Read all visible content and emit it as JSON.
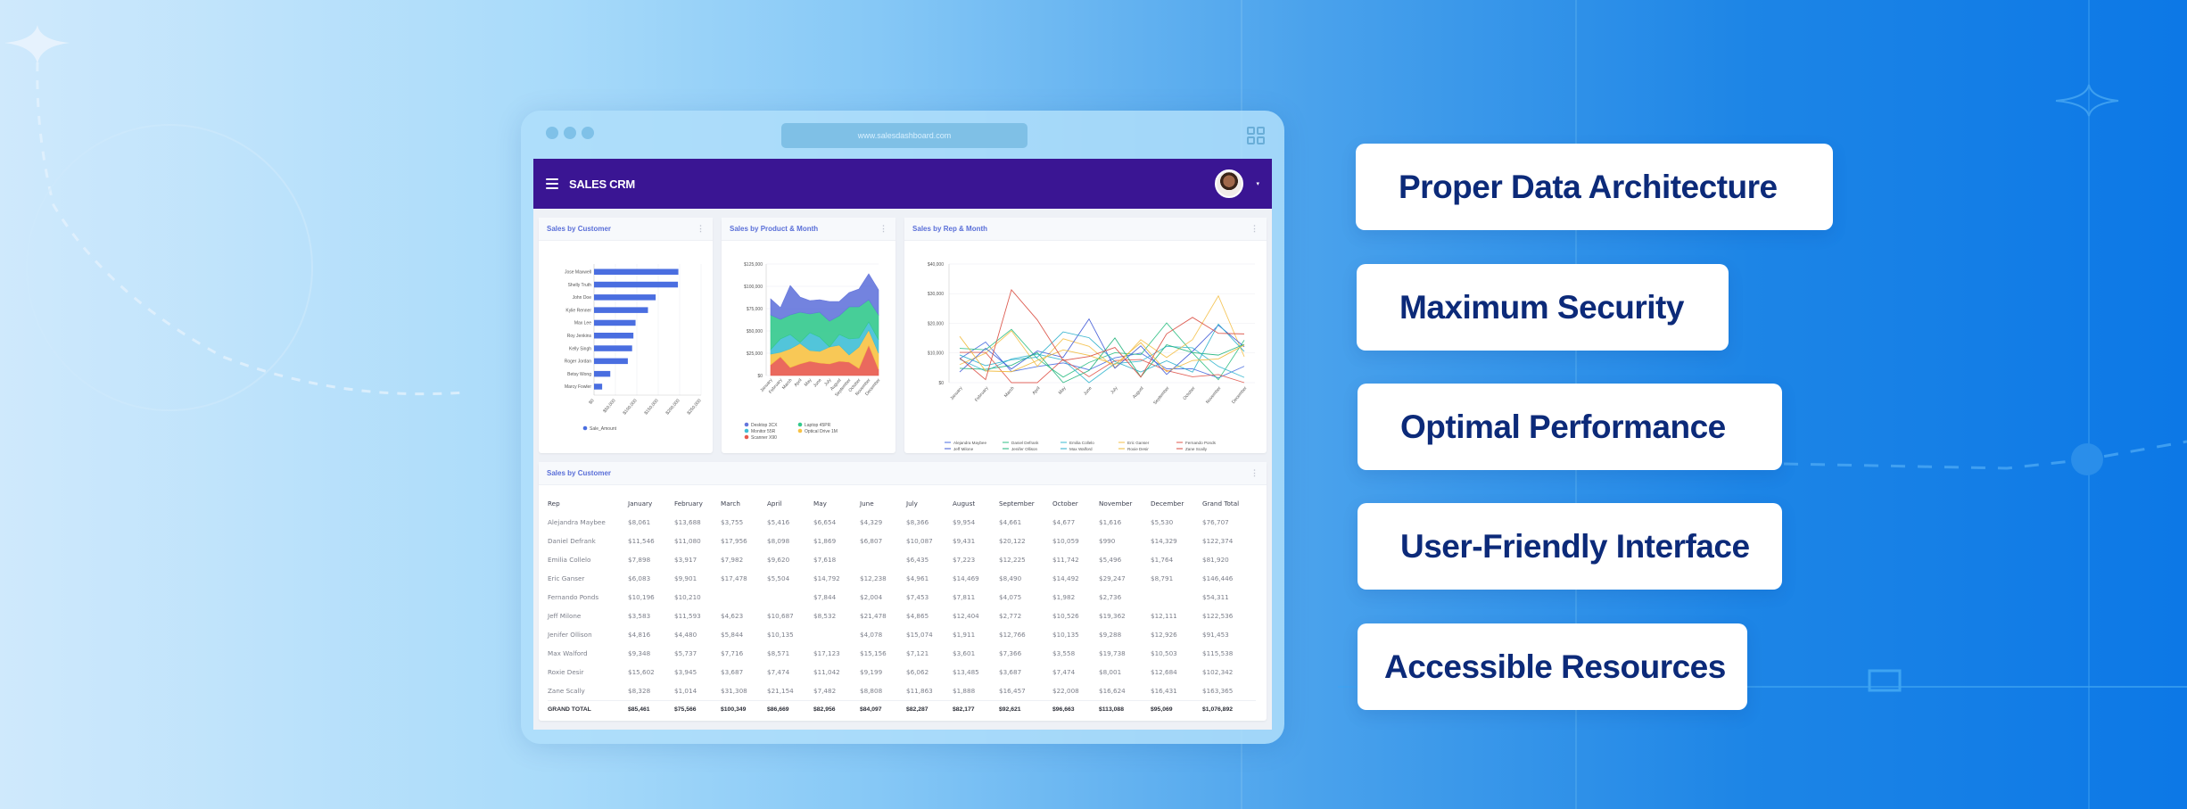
{
  "browser": {
    "url": "www.salesdashboard.com"
  },
  "app": {
    "title": "SALES CRM",
    "avatar_caret": "▾"
  },
  "cards": {
    "bar": {
      "title": "Sales by Customer",
      "menu": "⋮"
    },
    "area": {
      "title": "Sales by Product & Month",
      "menu": "⋮"
    },
    "line": {
      "title": "Sales by Rep & Month",
      "menu": "⋮"
    }
  },
  "table": {
    "title": "Sales by Customer",
    "menu": "⋮",
    "headers": [
      "Rep",
      "January",
      "February",
      "March",
      "April",
      "May",
      "June",
      "July",
      "August",
      "September",
      "October",
      "November",
      "December",
      "Grand Total"
    ],
    "rows": [
      [
        "Alejandra Maybee",
        "$8,061",
        "$13,688",
        "$3,755",
        "$5,416",
        "$6,654",
        "$4,329",
        "$8,366",
        "$9,954",
        "$4,661",
        "$4,677",
        "$1,616",
        "$5,530",
        "$76,707"
      ],
      [
        "Daniel Defrank",
        "$11,546",
        "$11,080",
        "$17,956",
        "$8,098",
        "$1,869",
        "$6,807",
        "$10,087",
        "$9,431",
        "$20,122",
        "$10,059",
        "$990",
        "$14,329",
        "$122,374"
      ],
      [
        "Emilia Collelo",
        "$7,898",
        "$3,917",
        "$7,982",
        "$9,620",
        "$7,618",
        "",
        "$6,435",
        "$7,223",
        "$12,225",
        "$11,742",
        "$5,496",
        "$1,764",
        "$81,920"
      ],
      [
        "Eric Ganser",
        "$6,083",
        "$9,901",
        "$17,478",
        "$5,504",
        "$14,792",
        "$12,238",
        "$4,961",
        "$14,469",
        "$8,490",
        "$14,492",
        "$29,247",
        "$8,791",
        "$146,446"
      ],
      [
        "Fernando Ponds",
        "$10,196",
        "$10,210",
        "",
        "",
        "$7,844",
        "$2,004",
        "$7,453",
        "$7,811",
        "$4,075",
        "$1,982",
        "$2,736",
        "",
        "$54,311"
      ],
      [
        "Jeff Milone",
        "$3,583",
        "$11,593",
        "$4,623",
        "$10,687",
        "$8,532",
        "$21,478",
        "$4,865",
        "$12,404",
        "$2,772",
        "$10,526",
        "$19,362",
        "$12,111",
        "$122,536"
      ],
      [
        "Jenifer Ollison",
        "$4,816",
        "$4,480",
        "$5,844",
        "$10,135",
        "",
        "$4,078",
        "$15,074",
        "$1,911",
        "$12,766",
        "$10,135",
        "$9,288",
        "$12,926",
        "$91,453"
      ],
      [
        "Max Walford",
        "$9,348",
        "$5,737",
        "$7,716",
        "$8,571",
        "$17,123",
        "$15,156",
        "$7,121",
        "$3,601",
        "$7,366",
        "$3,558",
        "$19,738",
        "$10,503",
        "$115,538"
      ],
      [
        "Roxie Desir",
        "$15,602",
        "$3,945",
        "$3,687",
        "$7,474",
        "$11,042",
        "$9,199",
        "$6,062",
        "$13,485",
        "$3,687",
        "$7,474",
        "$8,001",
        "$12,684",
        "$102,342"
      ],
      [
        "Zane Scally",
        "$8,328",
        "$1,014",
        "$31,308",
        "$21,154",
        "$7,482",
        "$8,808",
        "$11,863",
        "$1,888",
        "$16,457",
        "$22,008",
        "$16,624",
        "$16,431",
        "$163,365"
      ]
    ],
    "total": [
      "GRAND TOTAL",
      "$85,461",
      "$75,566",
      "$100,349",
      "$86,669",
      "$82,956",
      "$84,097",
      "$82,287",
      "$82,177",
      "$92,621",
      "$96,663",
      "$113,088",
      "$95,069",
      "$1,076,892"
    ]
  },
  "features": [
    {
      "label": "Proper Data Architecture"
    },
    {
      "label": "Maximum Security"
    },
    {
      "label": "Optimal Performance"
    },
    {
      "label": "User-Friendly Interface"
    },
    {
      "label": "Accessible Resources"
    }
  ],
  "chart_data": [
    {
      "type": "bar",
      "orientation": "horizontal",
      "title": "Sales by Customer",
      "categories": [
        "Jose Maxwell",
        "Shelly Truth",
        "John Doe",
        "Kylie Renner",
        "Max Lee",
        "Roy Jenkins",
        "Kelly Singh",
        "Roger Jordan",
        "Betsy Wong",
        "Marcy Fowler"
      ],
      "series": [
        {
          "name": "Sale_Amount",
          "color": "#4a6ee0",
          "values": [
            197000,
            196000,
            144000,
            126000,
            97000,
            92000,
            89000,
            79000,
            38000,
            19000
          ]
        }
      ],
      "xlim": [
        0,
        250000
      ],
      "xticks": [
        "$0",
        "$50,000",
        "$100,000",
        "$150,000",
        "$200,000",
        "$250,000"
      ],
      "grid": true,
      "legend": "bottom"
    },
    {
      "type": "area",
      "stacked": true,
      "title": "Sales by Product & Month",
      "categories": [
        "January",
        "February",
        "March",
        "April",
        "May",
        "June",
        "July",
        "August",
        "September",
        "October",
        "November",
        "December"
      ],
      "series": [
        {
          "name": "Scanner X90",
          "color": "#e8594d",
          "values": [
            12000,
            21000,
            9000,
            13000,
            16000,
            14000,
            13000,
            16000,
            15000,
            8000,
            34000,
            7000
          ]
        },
        {
          "name": "Optical Drive 1M",
          "color": "#f7c244",
          "values": [
            12000,
            5000,
            21000,
            23000,
            12000,
            13000,
            19000,
            18000,
            8000,
            24000,
            17000,
            18000
          ]
        },
        {
          "name": "Monitor 55R",
          "color": "#3fbfd6",
          "values": [
            5000,
            15000,
            16000,
            1000,
            20000,
            16000,
            0,
            12000,
            18000,
            10000,
            9000,
            15000
          ]
        },
        {
          "name": "Laptop 45PR",
          "color": "#33c98d",
          "values": [
            39000,
            22000,
            22000,
            34000,
            21000,
            28000,
            29000,
            21000,
            36000,
            35000,
            25000,
            28000
          ]
        },
        {
          "name": "Desktop 3CX",
          "color": "#6475dc",
          "values": [
            18000,
            13000,
            33000,
            17000,
            15000,
            14000,
            22000,
            16000,
            16000,
            20000,
            29000,
            28000
          ]
        }
      ],
      "legend_order": [
        "Desktop 3CX",
        "Laptop 45PR",
        "Monitor 55R",
        "Optical Drive 1M",
        "Scanner X90"
      ],
      "ylim": [
        0,
        125000
      ],
      "yticks": [
        "$0",
        "$25,000",
        "$50,000",
        "$75,000",
        "$100,000",
        "$125,000"
      ],
      "grid": true,
      "legend": "bottom"
    },
    {
      "type": "line",
      "title": "Sales by Rep & Month",
      "categories": [
        "January",
        "February",
        "March",
        "April",
        "May",
        "June",
        "July",
        "August",
        "September",
        "October",
        "November",
        "December"
      ],
      "series": [
        {
          "name": "Alejandra Maybee",
          "color": "#4a6ee0",
          "values": [
            8061,
            13688,
            3755,
            5416,
            6654,
            4329,
            8366,
            9954,
            4661,
            4677,
            1616,
            5530
          ]
        },
        {
          "name": "Daniel Defrank",
          "color": "#2fbf84",
          "values": [
            11546,
            11080,
            17956,
            8098,
            1869,
            6807,
            10087,
            9431,
            20122,
            10059,
            990,
            14329
          ]
        },
        {
          "name": "Emilia Collelo",
          "color": "#3ab8d0",
          "values": [
            7898,
            3917,
            7982,
            9620,
            7618,
            0,
            6435,
            7223,
            12225,
            11742,
            5496,
            1764
          ]
        },
        {
          "name": "Eric Ganser",
          "color": "#f4c04a",
          "values": [
            6083,
            9901,
            17478,
            5504,
            14792,
            12238,
            4961,
            14469,
            8490,
            14492,
            29247,
            8791
          ]
        },
        {
          "name": "Fernando Ponds",
          "color": "#e0574c",
          "values": [
            10196,
            10210,
            0,
            0,
            7844,
            2004,
            7453,
            7811,
            4075,
            1982,
            2736,
            0
          ]
        },
        {
          "name": "Jeff Milone",
          "color": "#3d58d6",
          "values": [
            3583,
            11593,
            4623,
            10687,
            8532,
            21478,
            4865,
            12404,
            2772,
            10526,
            19362,
            12111
          ]
        },
        {
          "name": "Jenifer Ollison",
          "color": "#1fb37a",
          "values": [
            4816,
            4480,
            5844,
            10135,
            0,
            4078,
            15074,
            1911,
            12766,
            10135,
            9288,
            12926
          ]
        },
        {
          "name": "Max Walford",
          "color": "#29aecb",
          "values": [
            9348,
            5737,
            7716,
            8571,
            17123,
            15156,
            7121,
            3601,
            7366,
            3558,
            19738,
            10503
          ]
        },
        {
          "name": "Roxie Desir",
          "color": "#efb836",
          "values": [
            15602,
            3945,
            3687,
            7474,
            11042,
            9199,
            6062,
            13485,
            3687,
            7474,
            8001,
            12684
          ]
        },
        {
          "name": "Zane Scally",
          "color": "#d94b3f",
          "values": [
            8328,
            1014,
            31308,
            21154,
            7482,
            8808,
            11863,
            1888,
            16457,
            22008,
            16624,
            16431
          ]
        }
      ],
      "ylim": [
        0,
        40000
      ],
      "yticks": [
        "$0",
        "$10,000",
        "$20,000",
        "$30,000",
        "$40,000"
      ],
      "grid": true,
      "legend": "bottom"
    }
  ]
}
